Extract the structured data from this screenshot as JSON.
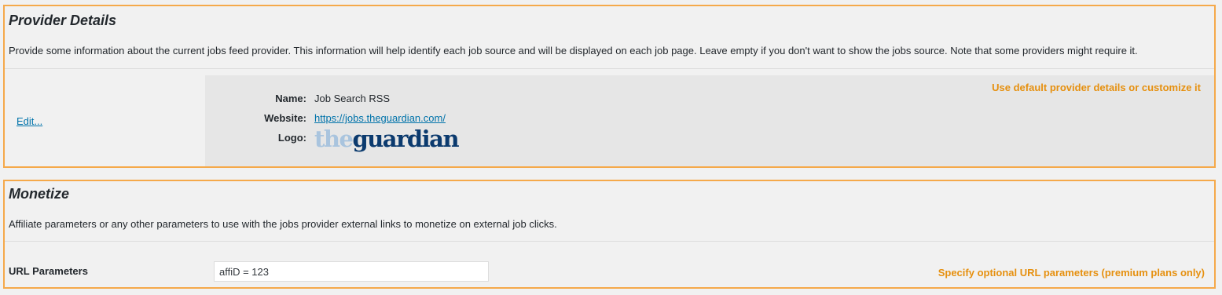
{
  "provider": {
    "title": "Provider Details",
    "description": "Provide some information about the current jobs feed provider. This information will help identify each job source and will be displayed on each job page. Leave empty if you don't want to show the jobs source. Note that some providers might require it.",
    "edit_label": "Edit...",
    "name_label": "Name:",
    "name_value": "Job Search RSS",
    "website_label": "Website:",
    "website_value": "https://jobs.theguardian.com/",
    "logo_label": "Logo:",
    "logo_text_the": "the",
    "logo_text_guardian": "guardian",
    "hint": "Use default provider details or customize it"
  },
  "monetize": {
    "title": "Monetize",
    "description": "Affiliate parameters or any other parameters to use with the jobs provider external links to monetize on external job clicks.",
    "url_label": "URL Parameters",
    "url_value": "affiD = 123",
    "hint": "Specify optional URL parameters (premium plans only)"
  },
  "colors": {
    "highlight_border": "#f5a94a",
    "hint_text": "#e6900f",
    "link": "#0073aa",
    "logo_light": "#a9c4de",
    "logo_dark": "#0b3a6e"
  }
}
